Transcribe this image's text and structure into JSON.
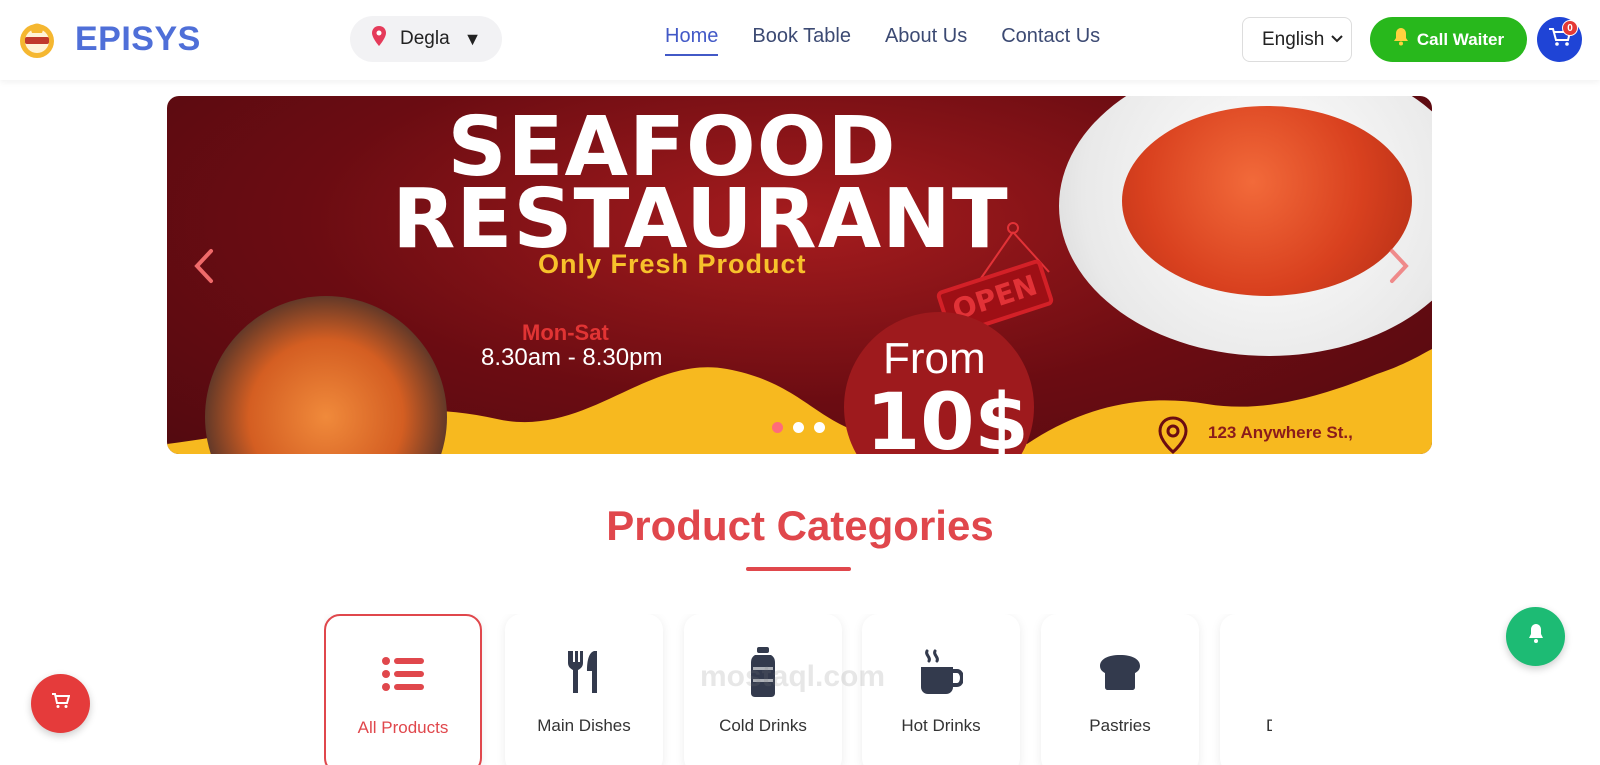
{
  "header": {
    "brand": "EPISYS",
    "branch": {
      "name": "Degla",
      "pin_icon": "map-pin-icon",
      "caret": "▼"
    },
    "nav": [
      {
        "label": "Home",
        "active": true
      },
      {
        "label": "Book Table",
        "active": false
      },
      {
        "label": "About Us",
        "active": false
      },
      {
        "label": "Contact Us",
        "active": false
      }
    ],
    "language": {
      "selected": "English"
    },
    "call_waiter": {
      "label": "Call Waiter",
      "icon": "bell-icon"
    },
    "cart": {
      "count": "0",
      "icon": "cart-icon"
    }
  },
  "banner": {
    "headline_line1": "SEAFOOD",
    "headline_line2": "RESTAURANT",
    "tagline": "Only Fresh Product",
    "days": "Mon-Sat",
    "hours": "8.30am - 8.30pm",
    "open_sign": "OPEN",
    "from_label": "From",
    "price": "10$",
    "address": "123 Anywhere St.,",
    "slides": 3,
    "active_slide": 1
  },
  "categories_section": {
    "title": "Product Categories",
    "items": [
      {
        "label": "All Products",
        "icon": "list-icon",
        "active": true
      },
      {
        "label": "Main Dishes",
        "icon": "utensils-icon",
        "active": false
      },
      {
        "label": "Cold Drinks",
        "icon": "bottle-icon",
        "active": false
      },
      {
        "label": "Hot Drinks",
        "icon": "mug-hot-icon",
        "active": false
      },
      {
        "label": "Pastries",
        "icon": "bread-icon",
        "active": false
      },
      {
        "label": "D",
        "icon": "",
        "active": false
      }
    ]
  },
  "watermark": "mostaql.com",
  "colors": {
    "brand_blue": "#4f6fd8",
    "accent_red": "#e0474c",
    "waiter_green": "#28b81c",
    "bell_green": "#1dbb74",
    "banner_maroon": "#6b0c12",
    "banner_yellow": "#f7b91f"
  }
}
